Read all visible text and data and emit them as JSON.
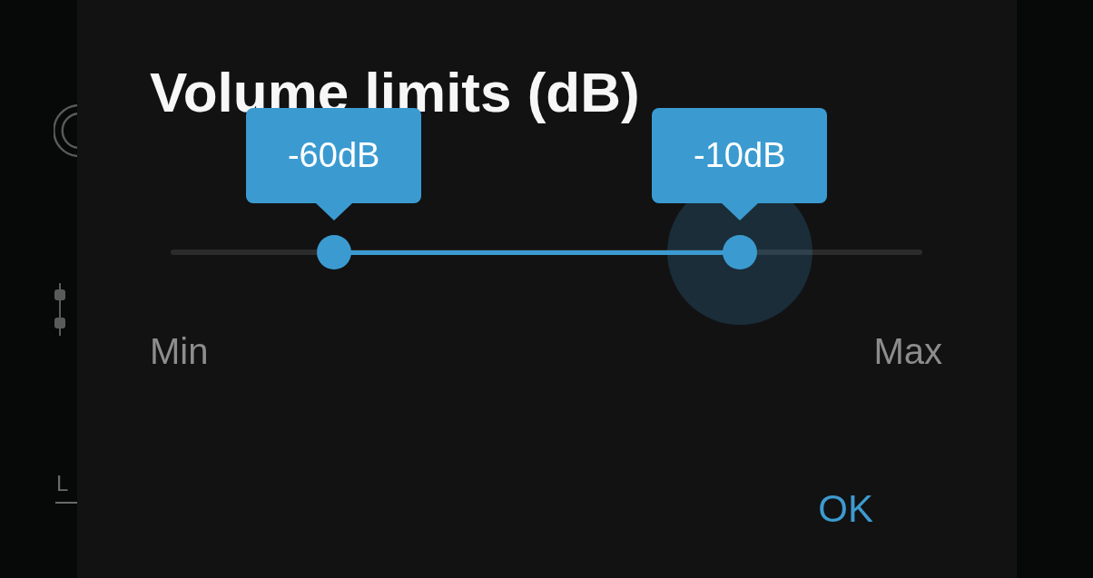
{
  "background": {
    "tab": {
      "label": "L",
      "selected": true
    }
  },
  "dialog": {
    "title": "Volume limits (dB)",
    "range_slider": {
      "thumbs": [
        {
          "value": "-60dB",
          "level": 0.217,
          "pressed": false
        },
        {
          "value": "-10dB",
          "level": 0.757,
          "pressed": true
        }
      ],
      "min_label": "Min",
      "max_label": "Max"
    },
    "buttons": [
      "OK"
    ]
  }
}
